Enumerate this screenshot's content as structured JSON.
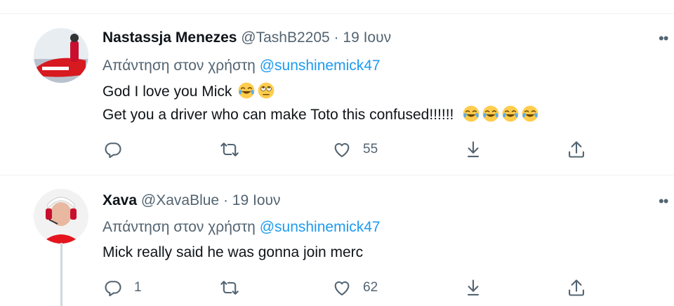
{
  "tweets": [
    {
      "name": "Nastassja Menezes",
      "handle": "@TashB2205",
      "separator": "·",
      "date": "19 Ιουν",
      "reply_prefix": "Απάντηση στον χρήστη",
      "reply_mention": "@sunshinemick47",
      "lines": [
        "God I love you Mick",
        "Get you a driver who can make Toto this confused!!!!!!"
      ],
      "line_emojis": [
        [
          "face-with-tears-of-joy",
          "face-with-rolling-eyes"
        ],
        [
          "face-with-tears-of-joy",
          "face-with-tears-of-joy",
          "face-with-tears-of-joy",
          "face-with-tears-of-joy"
        ]
      ],
      "reply_count": "",
      "retweet_count": "",
      "like_count": "55"
    },
    {
      "name": "Xava",
      "handle": "@XavaBlue",
      "separator": "·",
      "date": "19 Ιουν",
      "reply_prefix": "Απάντηση στον χρήστη",
      "reply_mention": "@sunshinemick47",
      "lines": [
        "Mick really said he was gonna join merc"
      ],
      "reply_count": "1",
      "retweet_count": "",
      "like_count": "62"
    }
  ],
  "icons": [
    "reply-icon",
    "retweet-icon",
    "like-icon",
    "download-icon",
    "share-icon",
    "more-icon"
  ],
  "colors": {
    "link": "#1d9bf0",
    "muted": "#536471",
    "text": "#0f1419",
    "divider": "#eff3f4"
  }
}
